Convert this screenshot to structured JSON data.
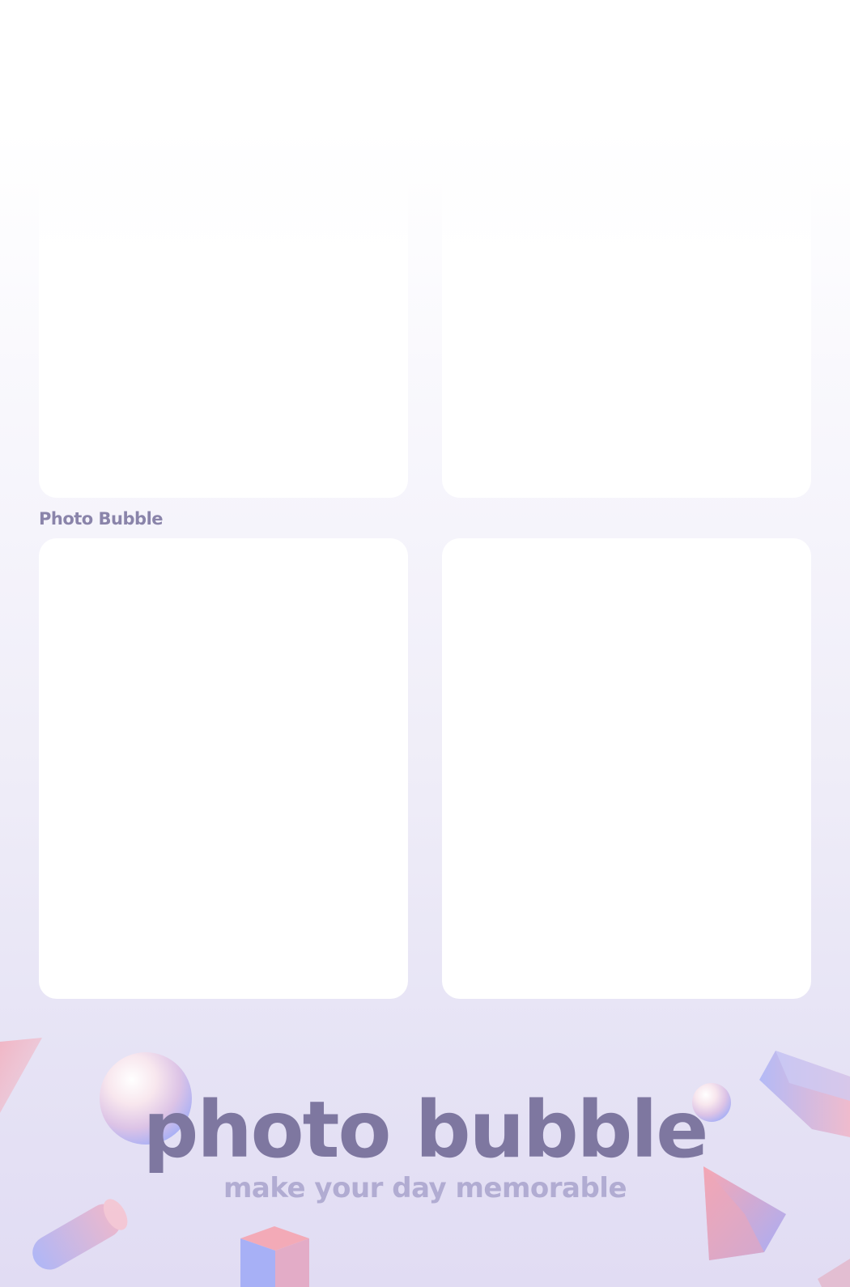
{
  "photo_slots": [
    {
      "label": ""
    },
    {
      "label": ""
    },
    {
      "label": ""
    },
    {
      "label": ""
    }
  ],
  "caption_small": "Photo Bubble",
  "brand": {
    "title": "photo bubble",
    "tagline": "make your day memorable"
  },
  "colors": {
    "title": "#7e77a0",
    "tagline": "#b1acd2",
    "small_caption": "#8a84aa",
    "pastel_pink": "#f7a7b3",
    "pastel_blue": "#a6aef7"
  },
  "decorations": [
    "sphere-large",
    "sphere-small",
    "cylinder",
    "cube",
    "pyramid",
    "prism",
    "triangle-shard-left",
    "bar-corner-right"
  ]
}
